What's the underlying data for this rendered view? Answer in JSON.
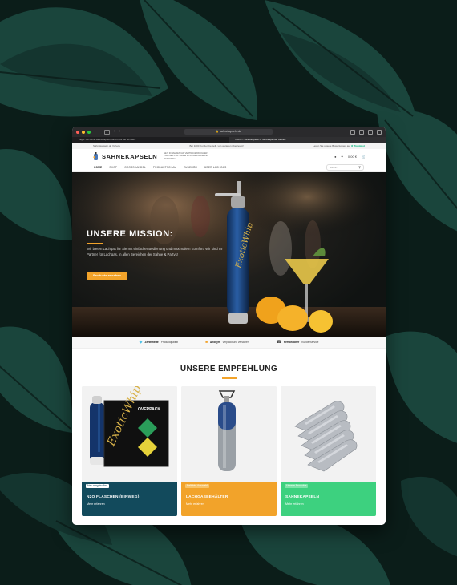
{
  "browser": {
    "url": "sahnekapseln.de",
    "tabs": [
      {
        "label": "Lager Sie mehr Sahnekapseln direkt aus der Schweiz"
      },
      {
        "label": "Home • Sahnekapseln & Sahnespender kaufen"
      }
    ]
  },
  "topbar": {
    "left": "Sahnekapseln.de Vorteile",
    "center": "Bei 1000 Kunden bestellt, von weiteren überzeugt!",
    "right": "Lesen Sie unsere Bewertungen auf",
    "trustpilot": "★ Trustpilot"
  },
  "header": {
    "logo_text": "SAHNEKAPSELN",
    "slogan": "SEIT 30 JAHREN IHR VERTRAUENSVOLLER PARTNER FÜR SAHNE & PROFESSIONELLE PATRONEN",
    "cart_amount": "0,00 €"
  },
  "nav": {
    "items": [
      {
        "label": "HOME",
        "active": true
      },
      {
        "label": "SHOP"
      },
      {
        "label": "GROSSHANDEL"
      },
      {
        "label": "PRODUKTSCHAU"
      },
      {
        "label": "ZUBEHÖR"
      },
      {
        "label": "ÜBER LACHGAS"
      }
    ],
    "search_placeholder": "Suche..."
  },
  "hero": {
    "title": "UNSERE MISSION:",
    "text": "Wir bieten Lachgas für Sie mit einfacher Bedienung und maximalem Komfort. Wir sind Ihr Partner für Lachgas, in allen Bereichen der Sahne & Partys!",
    "button": "Produkte ansehen",
    "bottle_label": "ExoticWhip"
  },
  "features": [
    {
      "bold": "Zertifizierte",
      "text": "Produktqualität",
      "color": "#4fc3e8"
    },
    {
      "bold": "Anonym",
      "text": "verpackt und versichert",
      "color": "#f2a32a"
    },
    {
      "bold": "Persönlicher",
      "text": "Kundenservice",
      "color": "#444444"
    }
  ],
  "section": {
    "title": "UNSERE EMPFEHLUNG"
  },
  "products": [
    {
      "badge": "Neu eingetroffen",
      "title": "N2O FLASCHEN (EINWEG)",
      "link": "Mehr erfahren",
      "color": "#124a5c",
      "badge_bg": "#ffffff",
      "badge_color": "#124a5c",
      "box_label": "OVERPACK"
    },
    {
      "badge": "Beliebte Auswahl",
      "title": "LACHGASBEHÄLTER",
      "link": "Mehr erfahren",
      "color": "#f2a32a",
      "badge_bg": "#f7c46a",
      "badge_color": "#ffffff"
    },
    {
      "badge": "Unsere Produkte",
      "title": "SAHNEKAPSELN",
      "link": "Mehr erfahren",
      "color": "#3dd17f",
      "badge_bg": "#7ee3a8",
      "badge_color": "#ffffff"
    }
  ]
}
